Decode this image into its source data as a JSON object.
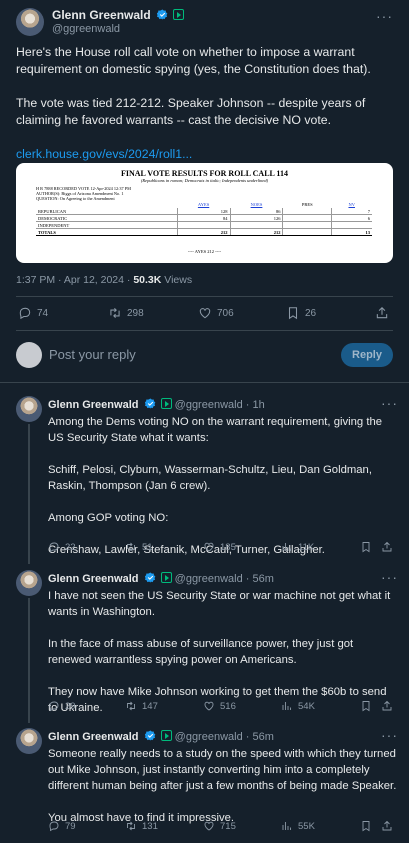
{
  "main": {
    "author_name": "Glenn Greenwald",
    "handle": "@ggreenwald",
    "paragraphs": [
      "Here's the House roll call vote on whether to impose a warrant requirement on domestic spying (yes, the Constitution does that).",
      "The vote was tied 212-212. Speaker Johnson -- despite years of claiming he favored warrants -- cast the decisive NO vote."
    ],
    "link": "clerk.house.gov/evs/2024/roll1...",
    "timestamp": "1:37 PM · Apr 12, 2024 · ",
    "views_count": "50.3K",
    "views_label": " Views",
    "stats": {
      "replies": "74",
      "reposts": "298",
      "likes": "706",
      "bookmarks": "26"
    }
  },
  "document": {
    "title": "FINAL VOTE RESULTS FOR ROLL CALL 114",
    "subtitle": "(Republicans in roman; Democrats in italic; Independents underlined)",
    "meta_line1": "H R 7888    RECORDED VOTE    12-Apr-2024    12:37 PM",
    "meta_line2": "AUTHOR(S): Biggs of Arizona Amendment No. 1",
    "meta_line3": "QUESTION: On Agreeing to the Amendment",
    "columns": [
      "",
      "AYES",
      "NOES",
      "PRES",
      "NV"
    ],
    "rows": [
      [
        "REPUBLICAN",
        "128",
        "86",
        "",
        "7"
      ],
      [
        "DEMOCRATIC",
        "84",
        "126",
        "",
        "6"
      ],
      [
        "INDEPENDENT",
        "",
        "",
        "",
        ""
      ],
      [
        "TOTALS",
        "212",
        "212",
        "",
        "13"
      ]
    ],
    "footer": "---- AYES    212 ----"
  },
  "composer": {
    "placeholder": "Post your reply",
    "button": "Reply"
  },
  "replies": [
    {
      "name": "Glenn Greenwald",
      "meta": "@ggreenwald · 1h",
      "paragraphs": [
        "Among the Dems voting NO on the warrant requirement, giving the US Security State what it wants:",
        "Schiff, Pelosi, Clyburn, Wasserman-Schultz, Lieu, Dan Goldman, Raskin, Thompson (Jan 6 crew).",
        "Among GOP voting NO:",
        "Crenshaw, Lawler, Stefanik, McCaul, Turner, Gallagher."
      ],
      "stats": {
        "replies": "22",
        "reposts": "51",
        "likes": "185",
        "views": "11K"
      }
    },
    {
      "name": "Glenn Greenwald",
      "meta": "@ggreenwald · 56m",
      "paragraphs": [
        "I have not seen the US Security State or war machine not get what it wants in Washington.",
        "In the face of mass abuse of surveillance power, they just got renewed warrantless spying power on Americans.",
        "They now have Mike Johnson working to get them the $60b to send to Ukraine."
      ],
      "stats": {
        "replies": "29",
        "reposts": "147",
        "likes": "516",
        "views": "54K"
      }
    },
    {
      "name": "Glenn Greenwald",
      "meta": "@ggreenwald · 56m",
      "paragraphs": [
        "Someone really needs to a study on the speed with which they turned out Mike Johnson, just instantly converting him into a completely different human being after just a few months of being made Speaker.",
        "You almost have to find it impressive."
      ],
      "stats": {
        "replies": "79",
        "reposts": "131",
        "likes": "715",
        "views": "55K"
      }
    }
  ],
  "colors": {
    "background": "#15202b",
    "accent": "#1d9bf0",
    "muted": "#8b98a5",
    "divider": "#38444d"
  }
}
